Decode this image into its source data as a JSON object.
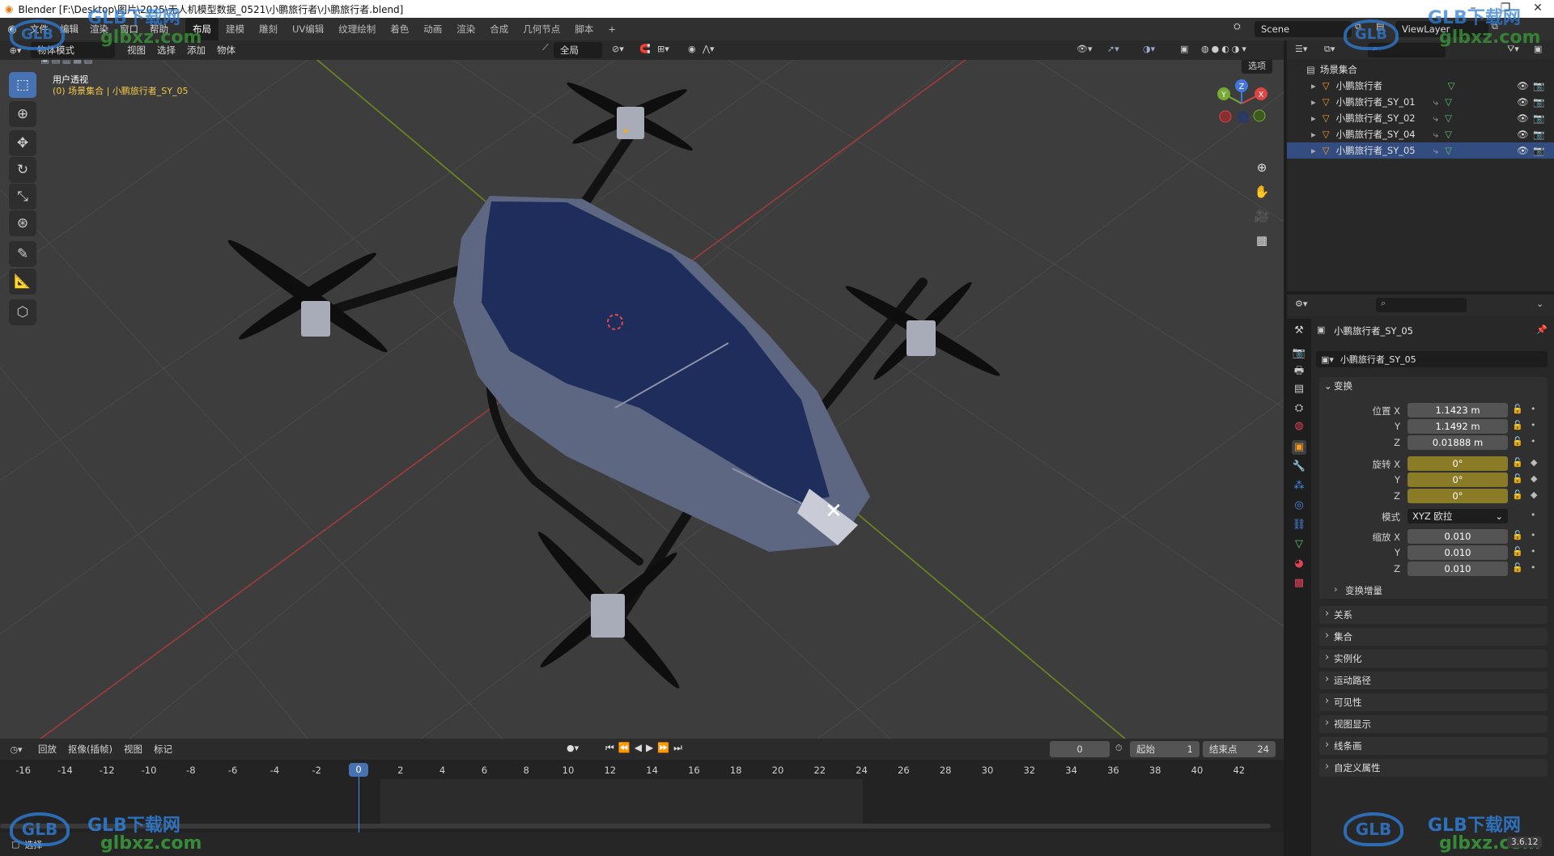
{
  "window": {
    "title": "Blender [F:\\Desktop\\图片\\2025\\无人机模型数据_0521\\小鹏旅行者\\小鹏旅行者.blend]"
  },
  "menus": [
    "文件",
    "编辑",
    "渲染",
    "窗口",
    "帮助"
  ],
  "workspaces": [
    "布局",
    "建模",
    "雕刻",
    "UV编辑",
    "纹理绘制",
    "着色",
    "动画",
    "渲染",
    "合成",
    "几何节点",
    "脚本"
  ],
  "workspace_add": "+",
  "scene": {
    "label": "Scene",
    "viewlayer": "ViewLayer"
  },
  "viewport": {
    "mode": "物体模式",
    "menus": [
      "视图",
      "选择",
      "添加",
      "物体"
    ],
    "orientation": "全局",
    "options": "选项",
    "view_name": "用户透视",
    "collection_info": "(0) 场景集合 | 小鹏旅行者_SY_05",
    "gizmo": {
      "x": "X",
      "y": "Y",
      "z": "Z"
    }
  },
  "tools": [
    "select-box",
    "cursor",
    "move",
    "rotate",
    "scale",
    "transform",
    "annotate",
    "measure",
    "add-cube"
  ],
  "outliner": {
    "root": "场景集合",
    "items": [
      {
        "name": "小鹏旅行者"
      },
      {
        "name": "小鹏旅行者_SY_01"
      },
      {
        "name": "小鹏旅行者_SY_02"
      },
      {
        "name": "小鹏旅行者_SY_04"
      },
      {
        "name": "小鹏旅行者_SY_05"
      }
    ]
  },
  "properties": {
    "object_name": "小鹏旅行者_SY_05",
    "object_name_field": "小鹏旅行者_SY_05",
    "transform_title": "变换",
    "location": {
      "label": "位置 X",
      "x": "1.1423 m",
      "y": "1.1492 m",
      "z": "0.01888 m"
    },
    "rotation": {
      "label": "旋转 X",
      "x": "0°",
      "y": "0°",
      "z": "0°"
    },
    "mode": {
      "label": "模式",
      "value": "XYZ 欧拉"
    },
    "scale": {
      "label": "缩放 X",
      "x": "0.010",
      "y": "0.010",
      "z": "0.010"
    },
    "axis_y": "Y",
    "axis_z": "Z",
    "delta": "变换增量",
    "sections": [
      "关系",
      "集合",
      "实例化",
      "运动路径",
      "可见性",
      "视图显示",
      "线条画",
      "自定义属性"
    ]
  },
  "timeline": {
    "menus": [
      "回放",
      "抠像(插帧)",
      "视图",
      "标记"
    ],
    "current_frame": "0",
    "start_label": "起始",
    "start": "1",
    "end_label": "结束点",
    "end": "24",
    "frames": [
      "-16",
      "-14",
      "-12",
      "-10",
      "-8",
      "-6",
      "-4",
      "-2",
      "0",
      "2",
      "4",
      "6",
      "8",
      "10",
      "12",
      "14",
      "16",
      "18",
      "20",
      "22",
      "24",
      "26",
      "28",
      "30",
      "32",
      "34",
      "36",
      "38",
      "40",
      "42"
    ]
  },
  "statusbar": {
    "left": "选择",
    "version": "3.6.12"
  },
  "watermarks": [
    "GLB下载网",
    "glbxz.com"
  ]
}
